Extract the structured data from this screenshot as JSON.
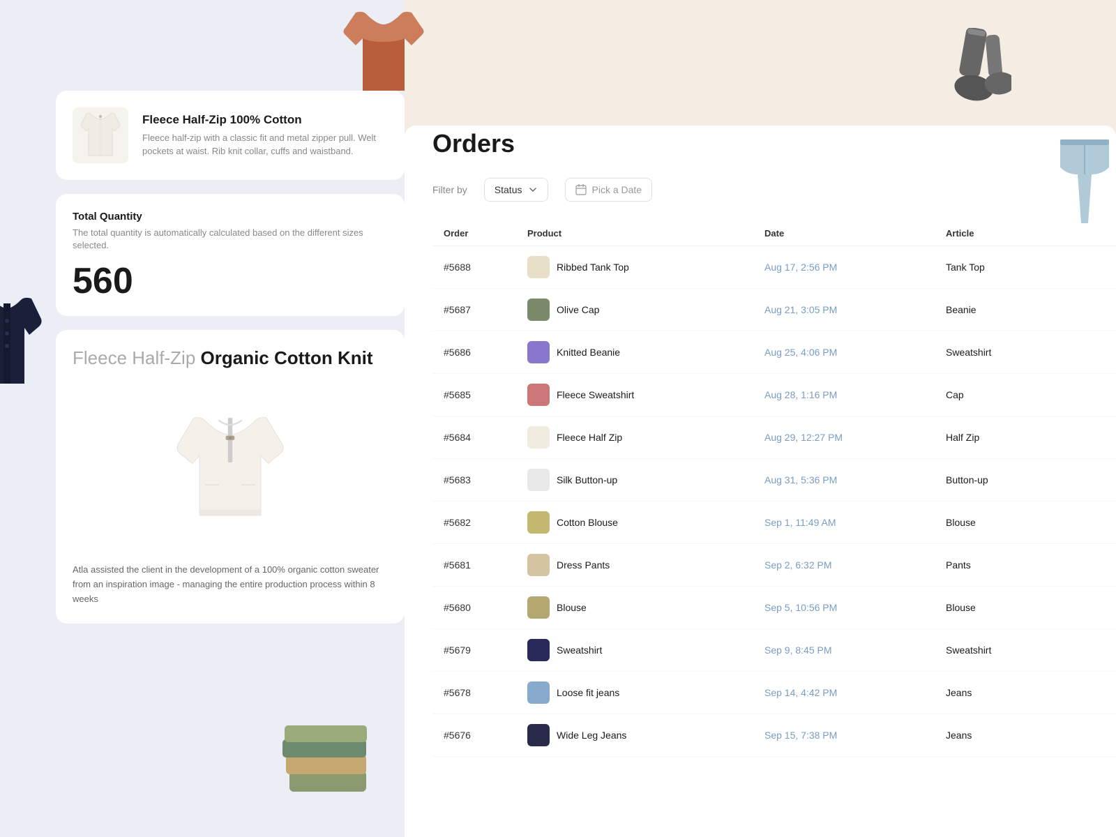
{
  "background": {
    "left_color": "#eceef5",
    "right_color": "#f5ece4"
  },
  "product_card": {
    "title": "Fleece Half-Zip 100% Cotton",
    "description": "Fleece half-zip with a classic fit and metal zipper pull. Welt pockets at waist. Rib knit collar, cuffs and waistband."
  },
  "quantity_card": {
    "title": "Total Quantity",
    "description": "The total quantity is automatically calculated based on the different sizes selected.",
    "value": "560"
  },
  "product_detail": {
    "title_light": "Fleece Half-Zip",
    "title_bold": "Organic Cotton Knit",
    "description": "Atla assisted the client in the development of a 100% organic cotton sweater from an inspiration image - managing the entire production process within 8 weeks"
  },
  "orders": {
    "title": "Orders",
    "filter_label": "Filter by",
    "status_label": "Status",
    "date_placeholder": "Pick a Date",
    "columns": [
      "Order",
      "Product",
      "Date",
      "Article"
    ],
    "rows": [
      {
        "order": "#5688",
        "product": "Ribbed Tank Top",
        "icon": "👕",
        "date": "Aug 17, 2:56 PM",
        "article": "Tank Top"
      },
      {
        "order": "#5687",
        "product": "Olive Cap",
        "icon": "🧢",
        "date": "Aug 21, 3:05 PM",
        "article": "Beanie"
      },
      {
        "order": "#5686",
        "product": "Knitted Beanie",
        "icon": "🎩",
        "date": "Aug 25, 4:06 PM",
        "article": "Sweatshirt"
      },
      {
        "order": "#5685",
        "product": "Fleece Sweatshirt",
        "icon": "👘",
        "date": "Aug 28, 1:16 PM",
        "article": "Cap"
      },
      {
        "order": "#5684",
        "product": "Fleece Half Zip",
        "icon": "👕",
        "date": "Aug 29, 12:27 PM",
        "article": "Half Zip"
      },
      {
        "order": "#5683",
        "product": "Silk Button-up",
        "icon": "👔",
        "date": "Aug 31, 5:36 PM",
        "article": "Button-up"
      },
      {
        "order": "#5682",
        "product": "Cotton Blouse",
        "icon": "👗",
        "date": "Sep 1, 11:49 AM",
        "article": "Blouse"
      },
      {
        "order": "#5681",
        "product": "Dress Pants",
        "icon": "👖",
        "date": "Sep 2, 6:32 PM",
        "article": "Pants"
      },
      {
        "order": "#5680",
        "product": "Blouse",
        "icon": "👗",
        "date": "Sep 5, 10:56 PM",
        "article": "Blouse"
      },
      {
        "order": "#5679",
        "product": "Sweatshirt",
        "icon": "👕",
        "date": "Sep 9, 8:45 PM",
        "article": "Sweatshirt"
      },
      {
        "order": "#5678",
        "product": "Loose fit jeans",
        "icon": "👖",
        "date": "Sep 14, 4:42 PM",
        "article": "Jeans"
      },
      {
        "order": "#5676",
        "product": "Wide Leg Jeans",
        "icon": "👖",
        "date": "Sep 15, 7:38 PM",
        "article": "Jeans"
      }
    ]
  },
  "product_thumb_colors": {
    "#5688": "#e8e0d0",
    "#5687": "#9aa88a",
    "#5686": "#9988cc",
    "#5685": "#cc8888",
    "#5684": "#f0ece0",
    "#5683": "#e8e8e8",
    "#5682": "#c4b870",
    "#5681": "#d4c4a0",
    "#5680": "#b4a870",
    "#5679": "#2a2a5a",
    "#5678": "#88aacc",
    "#5676": "#2a2a4a"
  }
}
